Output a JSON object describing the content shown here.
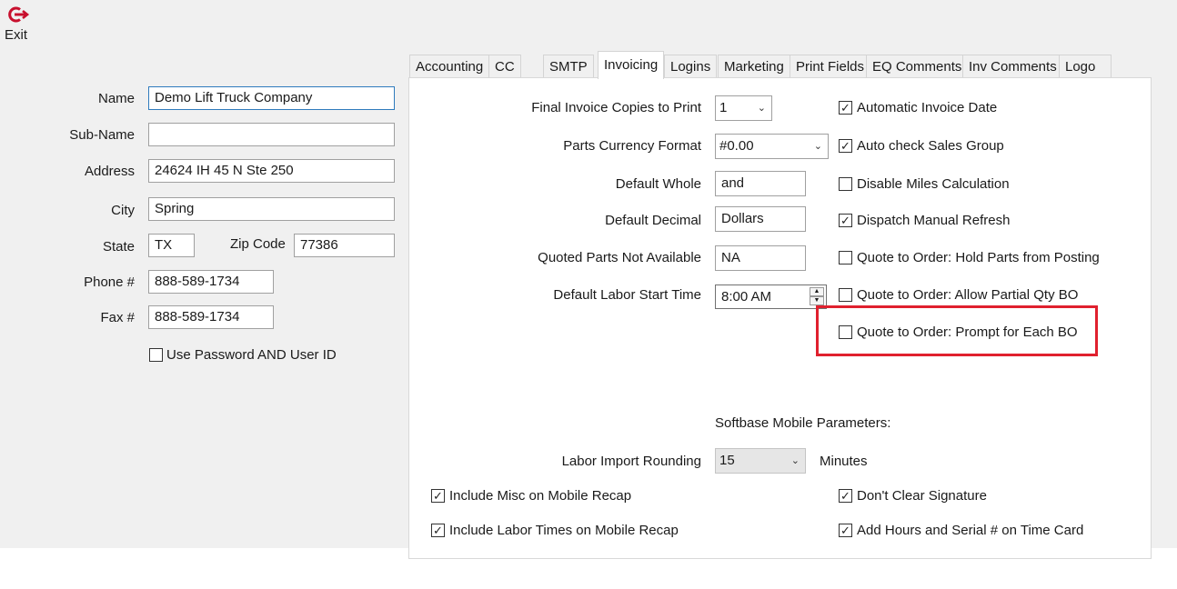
{
  "toolbar": {
    "exit_label": "Exit"
  },
  "company": {
    "name_label": "Name",
    "name_value": "Demo Lift Truck Company",
    "subname_label": "Sub-Name",
    "subname_value": "",
    "address_label": "Address",
    "address_value": "24624 IH 45 N Ste 250",
    "city_label": "City",
    "city_value": "Spring",
    "state_label": "State",
    "state_value": "TX",
    "zip_label": "Zip Code",
    "zip_value": "77386",
    "phone_label": "Phone #",
    "phone_value": "888-589-1734",
    "fax_label": "Fax #",
    "fax_value": "888-589-1734",
    "use_password_label": "Use Password AND User ID",
    "use_password_checked": false
  },
  "tabs": [
    {
      "label": "Accounting"
    },
    {
      "label": "CC"
    },
    {
      "label": "SMTP"
    },
    {
      "label": "Invoicing"
    },
    {
      "label": "Logins"
    },
    {
      "label": "Marketing"
    },
    {
      "label": "Print Fields"
    },
    {
      "label": "EQ Comments"
    },
    {
      "label": "Inv Comments"
    },
    {
      "label": "Logo"
    }
  ],
  "active_tab": "Invoicing",
  "invoicing": {
    "copies_label": "Final Invoice Copies to Print",
    "copies_value": "1",
    "currency_label": "Parts Currency Format",
    "currency_value": "#0.00",
    "whole_label": "Default Whole",
    "whole_value": "and",
    "decimal_label": "Default Decimal",
    "decimal_value": "Dollars",
    "not_available_label": "Quoted Parts Not Available",
    "not_available_value": "NA",
    "labor_start_label": "Default Labor Start Time",
    "labor_start_value": "8:00 AM",
    "options": [
      {
        "label": "Automatic Invoice Date",
        "checked": true
      },
      {
        "label": "Auto check Sales Group",
        "checked": true
      },
      {
        "label": "Disable Miles Calculation",
        "checked": false
      },
      {
        "label": "Dispatch Manual Refresh",
        "checked": true
      },
      {
        "label": "Quote to Order: Hold Parts from Posting",
        "checked": false
      },
      {
        "label": "Quote to Order: Allow Partial Qty BO",
        "checked": false
      },
      {
        "label": "Quote to Order: Prompt for Each BO",
        "checked": false
      }
    ],
    "mobile_header": "Softbase Mobile Parameters:",
    "rounding_label": "Labor Import Rounding",
    "rounding_value": "15",
    "rounding_unit": "Minutes",
    "mobile_options": [
      {
        "label": "Include Misc on Mobile Recap",
        "checked": true
      },
      {
        "label": "Include Labor Times on Mobile Recap",
        "checked": true
      },
      {
        "label": "Don't Clear Signature",
        "checked": true
      },
      {
        "label": "Add Hours and Serial # on Time Card",
        "checked": true
      }
    ]
  },
  "colors": {
    "exit_icon": "#c8102e",
    "highlight": "#e0202e",
    "focus_border": "#2f7bbd"
  }
}
